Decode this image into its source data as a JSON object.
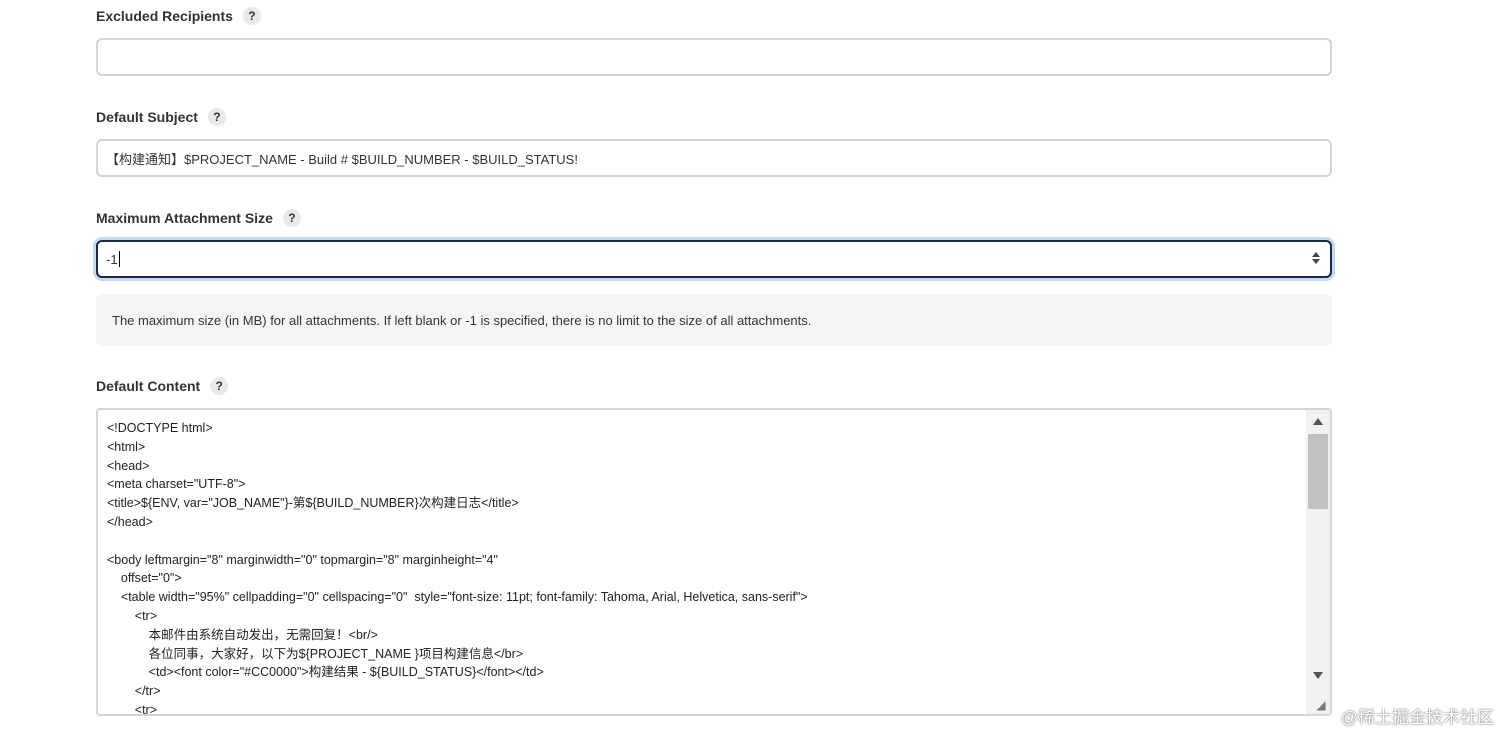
{
  "fields": {
    "excluded_recipients": {
      "label": "Excluded Recipients",
      "help": "?",
      "value": ""
    },
    "default_subject": {
      "label": "Default Subject",
      "help": "?",
      "value": "【构建通知】$PROJECT_NAME - Build # $BUILD_NUMBER - $BUILD_STATUS!"
    },
    "max_attachment_size": {
      "label": "Maximum Attachment Size",
      "help": "?",
      "value": "-1",
      "help_text": "The maximum size (in MB) for all attachments. If left blank or -1 is specified, there is no limit to the size of all attachments."
    },
    "default_content": {
      "label": "Default Content",
      "help": "?",
      "value": "<!DOCTYPE html>\n<html>\n<head>\n<meta charset=\"UTF-8\">\n<title>${ENV, var=\"JOB_NAME\"}-第${BUILD_NUMBER}次构建日志</title>\n</head>\n\n<body leftmargin=\"8\" marginwidth=\"0\" topmargin=\"8\" marginheight=\"4\"\n    offset=\"0\">\n    <table width=\"95%\" cellpadding=\"0\" cellspacing=\"0\"  style=\"font-size: 11pt; font-family: Tahoma, Arial, Helvetica, sans-serif\">\n        <tr>\n            本邮件由系统自动发出，无需回复！<br/>\n            各位同事，大家好，以下为${PROJECT_NAME }项目构建信息</br>\n            <td><font color=\"#CC0000\">构建结果 - ${BUILD_STATUS}</font></td>\n        </tr>\n        <tr>"
    }
  },
  "watermark": "@稀土掘金技术社区",
  "colors": {
    "focus_border": "#1a2a48",
    "focus_ring": "#c6d9ed",
    "help_bg": "#f5f5f5"
  }
}
